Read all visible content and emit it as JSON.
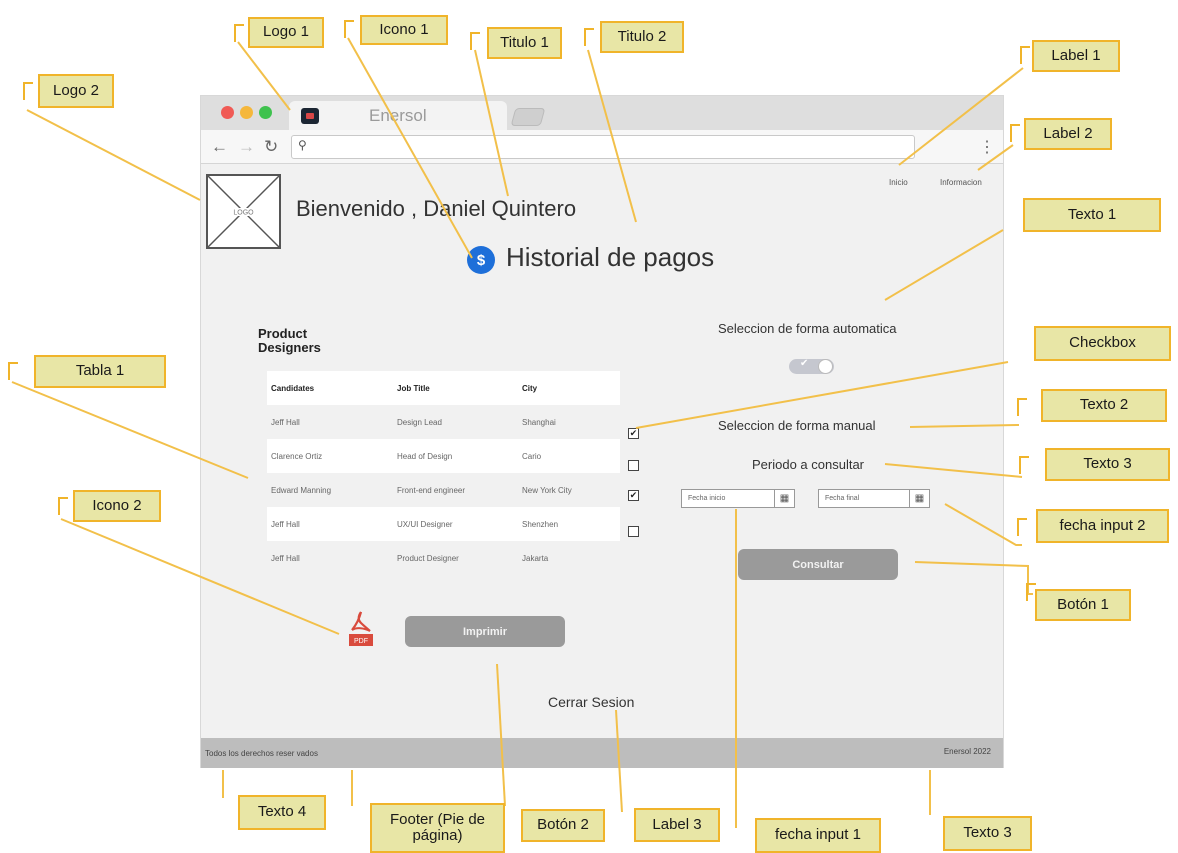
{
  "browser": {
    "tab_title": "Enersol",
    "colors": {
      "close": "#f05a55",
      "minimize": "#f5b73b",
      "maximize": "#3fc24e"
    }
  },
  "page": {
    "nav": {
      "inicio": "Inicio",
      "informacion": "Informacion"
    },
    "logo_placeholder": "LOGO",
    "welcome": "Bienvenido ,  Daniel Quintero",
    "history_icon": "$",
    "history_title": "Historial de pagos",
    "table": {
      "title": "Product Designers",
      "headers": [
        "Candidates",
        "Job Title",
        "City"
      ],
      "rows": [
        [
          "Jeff Hall",
          "Design Lead",
          "Shanghai"
        ],
        [
          "Clarence Ortiz",
          "Head of Design",
          "Cario"
        ],
        [
          "Edward Manning",
          "Front-end engineer",
          "New York City"
        ],
        [
          "Jeff Hall",
          "UX/UI Designer",
          "Shenzhen"
        ],
        [
          "Jeff Hall",
          "Product Designer",
          "Jakarta"
        ]
      ]
    },
    "checkboxes": [
      true,
      false,
      true,
      false
    ],
    "auto_text": "Seleccion de  forma automatica",
    "toggle_on": true,
    "manual_text": "Seleccion de forma  manual",
    "period_text": "Periodo a consultar",
    "date_start_placeholder": "Fecha inicio",
    "date_end_placeholder": "Fecha final",
    "query_button": "Consultar",
    "pdf_label": "PDF",
    "print_button": "Imprimir",
    "logout": "Cerrar Sesion",
    "footer_left": "Todos los derechos reser vados",
    "footer_right": "Enersol 2022"
  },
  "annotations": {
    "logo1": "Logo 1",
    "icono1": "Icono 1",
    "titulo1": "Titulo 1",
    "titulo2": "Titulo 2",
    "logo2": "Logo 2",
    "label1": "Label 1",
    "label2": "Label 2",
    "texto1": "Texto 1",
    "checkbox": "Checkbox",
    "tabla1": "Tabla 1",
    "texto2": "Texto 2",
    "texto3": "Texto 3",
    "icono2": "Icono 2",
    "fecha_input2": "fecha input 2",
    "boton1": "Botón 1",
    "texto4": "Texto 4",
    "footer": "Footer (Pie de página)",
    "boton2": "Botón 2",
    "label3": "Label 3",
    "fecha_input1": "fecha input 1",
    "texto3_bottom": "Texto 3"
  }
}
